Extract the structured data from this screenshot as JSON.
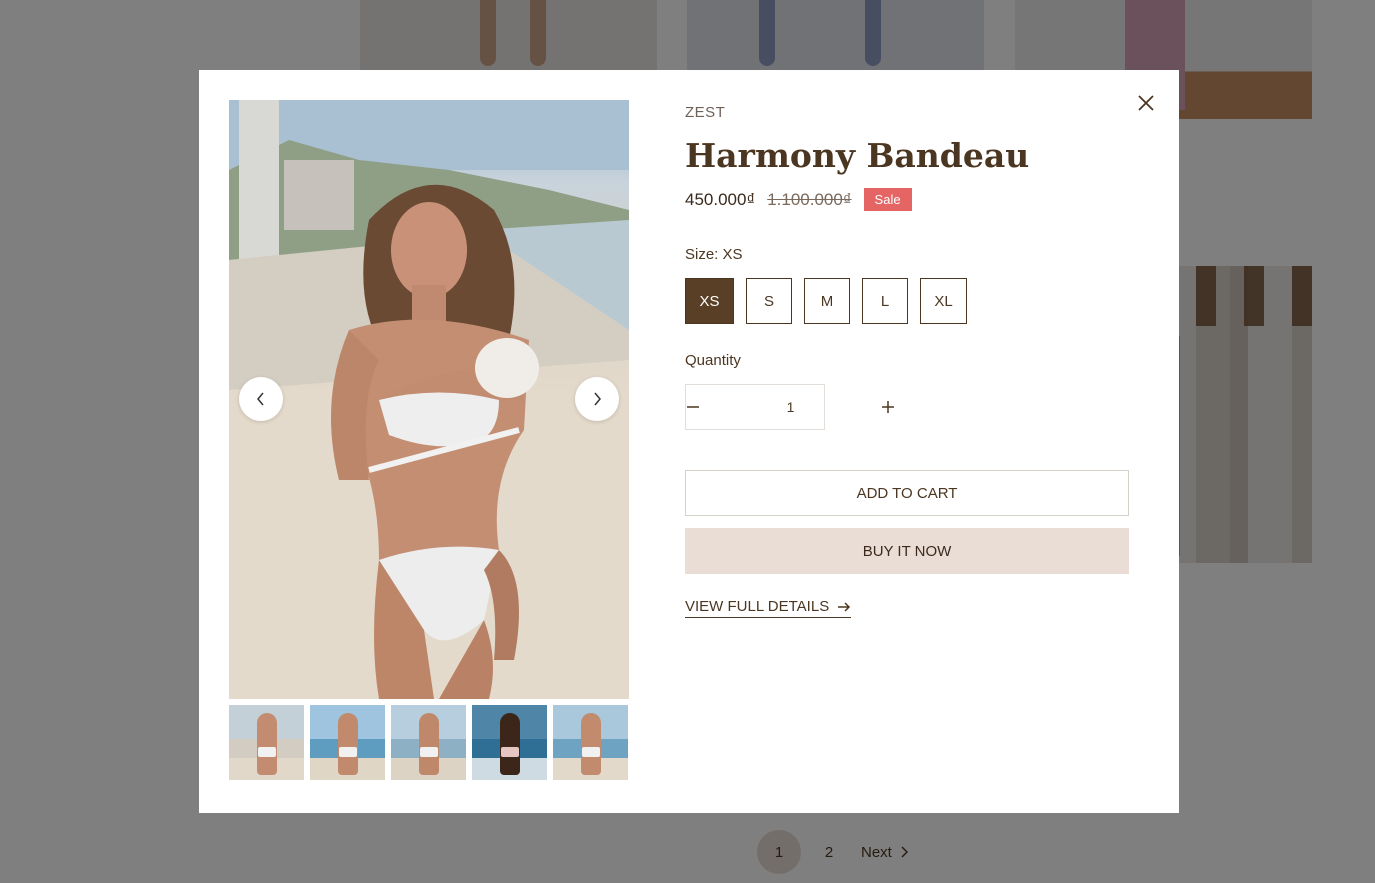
{
  "product": {
    "vendor": "ZEST",
    "title": "Harmony Bandeau",
    "price": "450.000₫",
    "compare_price": "1.100.000₫",
    "badge": "Sale"
  },
  "size": {
    "label": "Size:",
    "selected": "XS",
    "options": [
      "XS",
      "S",
      "M",
      "L",
      "XL"
    ]
  },
  "quantity": {
    "label": "Quantity",
    "value": "1"
  },
  "actions": {
    "add_to_cart": "ADD TO CART",
    "buy_now": "BUY IT NOW",
    "view_details": "VIEW FULL DETAILS"
  },
  "gallery": {
    "thumb_count": 5,
    "active_index": 0
  },
  "pagination": {
    "pages": [
      "1",
      "2"
    ],
    "current": "1",
    "next_label": "Next"
  },
  "icons": {
    "close": "close-icon",
    "prev": "chevron-left-icon",
    "next": "chevron-right-icon",
    "minus": "minus-icon",
    "plus": "plus-icon",
    "arrow": "arrow-right-icon"
  },
  "colors": {
    "text": "#4b3621",
    "size_active_bg": "#5a3f27",
    "sale_badge": "#e56565",
    "buy_now_bg": "#eaddd6"
  }
}
